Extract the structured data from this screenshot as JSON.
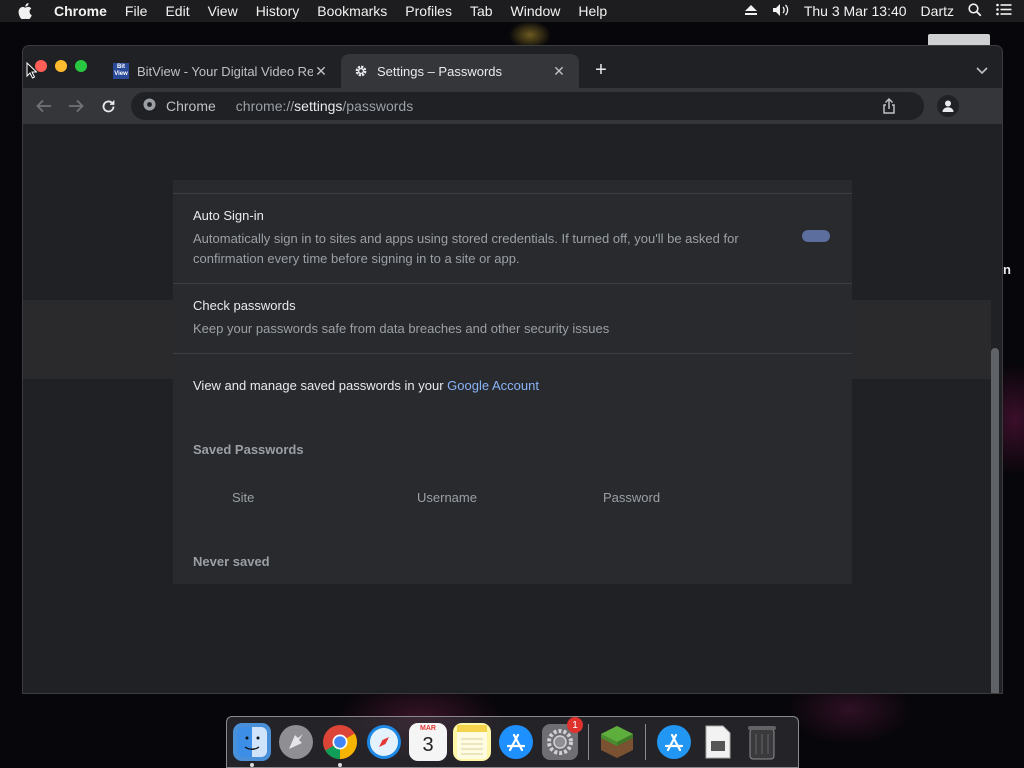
{
  "menubar": {
    "app_name": "Chrome",
    "items": [
      "File",
      "Edit",
      "View",
      "History",
      "Bookmarks",
      "Profiles",
      "Tab",
      "Window",
      "Help"
    ],
    "datetime": "Thu 3 Mar  13:40",
    "user": "Dartz"
  },
  "tabs": [
    {
      "title": "BitView - Your Digital Video Re",
      "favicon_text": "Bit View",
      "icon": "bitview-favicon"
    },
    {
      "title": "Settings – Passwords",
      "icon": "gear-icon"
    }
  ],
  "omnibox": {
    "chip_label": "Chrome",
    "url_prefix": "chrome://",
    "url_host": "settings",
    "url_path": "/passwords"
  },
  "settings": {
    "auto_signin": {
      "label": "Auto Sign-in",
      "description": "Automatically sign in to sites and apps using stored credentials. If turned off, you'll be asked for confirmation every time before signing in to a site or app.",
      "enabled": true
    },
    "check_passwords": {
      "label": "Check passwords",
      "description": "Keep your passwords safe from data breaches and other security issues"
    },
    "manage_text": "View and manage saved passwords in your ",
    "manage_link": "Google Account",
    "saved_passwords_title": "Saved Passwords",
    "columns": [
      "Site",
      "Username",
      "Password"
    ],
    "never_saved_title": "Never saved"
  },
  "desktop": {
    "side_letter": "n"
  },
  "dock": {
    "calendar_month": "MAR",
    "calendar_day": "3",
    "settings_badge": "1",
    "apps": [
      "finder",
      "launchpad",
      "chrome",
      "safari",
      "calendar",
      "notes",
      "app-store",
      "system-preferences",
      "minecraft",
      "app-store-downloads",
      "file",
      "trash"
    ]
  },
  "colors": {
    "accent_link": "#8ab4f8",
    "toggle_on": "#5c6e9e",
    "window_bg": "#202124",
    "card_bg": "#292a2d"
  }
}
